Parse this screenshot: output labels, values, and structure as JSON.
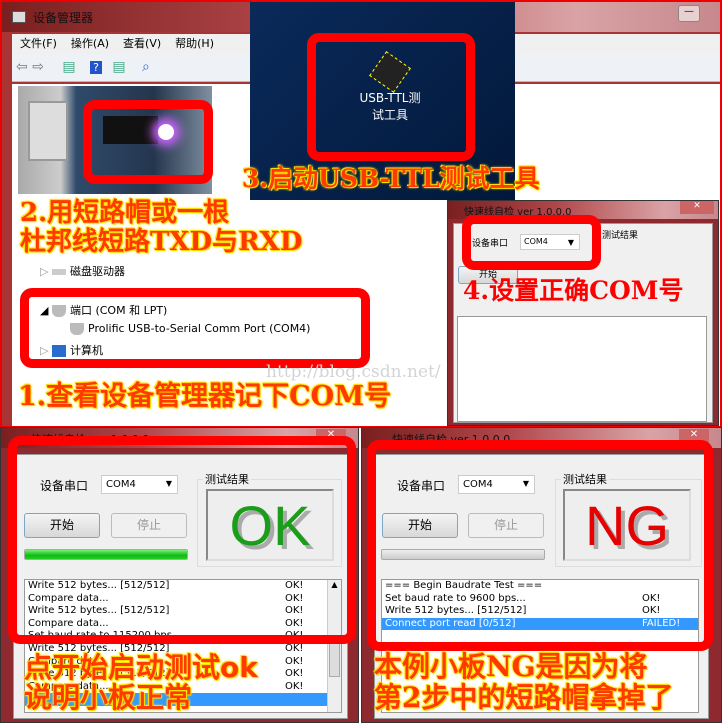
{
  "device_manager": {
    "title": "设备管理器",
    "menu": [
      "文件(F)",
      "操作(A)",
      "查看(V)",
      "帮助(H)"
    ],
    "tree": [
      {
        "label": "磁盘驱动器",
        "expanded": false
      },
      {
        "label": "端口 (COM 和 LPT)",
        "expanded": true
      },
      {
        "label": "Prolific USB-to-Serial Comm Port (COM4)",
        "child": true
      },
      {
        "label": "计算机",
        "expanded": false
      }
    ]
  },
  "desktop_icon": {
    "icon": "chip-test-icon",
    "icon_text": "TEST",
    "label_line1": "USB-TTL测",
    "label_line2": "试工具"
  },
  "captions": {
    "step1": "1.查看设备管理器记下COM号",
    "step2_line1": "2.用短路帽或一根",
    "step2_line2": "杜邦线短路TXD与RXD",
    "step3": "3.启动USB-TTL测试工具",
    "step4": "4.设置正确COM号",
    "ok_line1": "点开始启动测试ok",
    "ok_line2": "说明小板正常",
    "ng_line1": "本例小板NG是因为将",
    "ng_line2": "第2步中的短路帽拿掉了"
  },
  "watermark": "http://blog.csdn.net/",
  "app": {
    "title": "快速线自检  ver 1.0.0.0",
    "port_label": "设备串口",
    "port_value": "COM4",
    "start": "开始",
    "stop": "停止",
    "result_group": "测试结果"
  },
  "ok_window": {
    "result": "OK",
    "result_color": "#1a9e1a",
    "progress": 100,
    "log": [
      {
        "text": "Write 512 bytes... [512/512]",
        "status": "OK!"
      },
      {
        "text": "Compare data...",
        "status": "OK!"
      },
      {
        "text": "Write 512 bytes... [512/512]",
        "status": "OK!"
      },
      {
        "text": "Compare data...",
        "status": "OK!"
      },
      {
        "text": "Set baud rate to 115200 bps...",
        "status": "OK!"
      },
      {
        "text": "Write 512 bytes... [512/512]",
        "status": "OK!"
      },
      {
        "text": "Compare data...",
        "status": "OK!"
      },
      {
        "text": "Write 512 bytes... [512/512]",
        "status": "OK!"
      },
      {
        "text": "Compare data...",
        "status": "OK!"
      },
      {
        "text": "",
        "status": "",
        "selected": true
      }
    ]
  },
  "ng_window": {
    "result": "NG",
    "result_color": "#e60000",
    "progress": 0,
    "log": [
      {
        "text": "=== Begin Baudrate Test ===",
        "status": ""
      },
      {
        "text": "Set baud rate to 9600 bps...",
        "status": "OK!"
      },
      {
        "text": "Write 512 bytes... [512/512]",
        "status": "OK!"
      },
      {
        "text": "Connect port read [0/512]",
        "status": "FAILED!",
        "selected": true
      }
    ]
  }
}
